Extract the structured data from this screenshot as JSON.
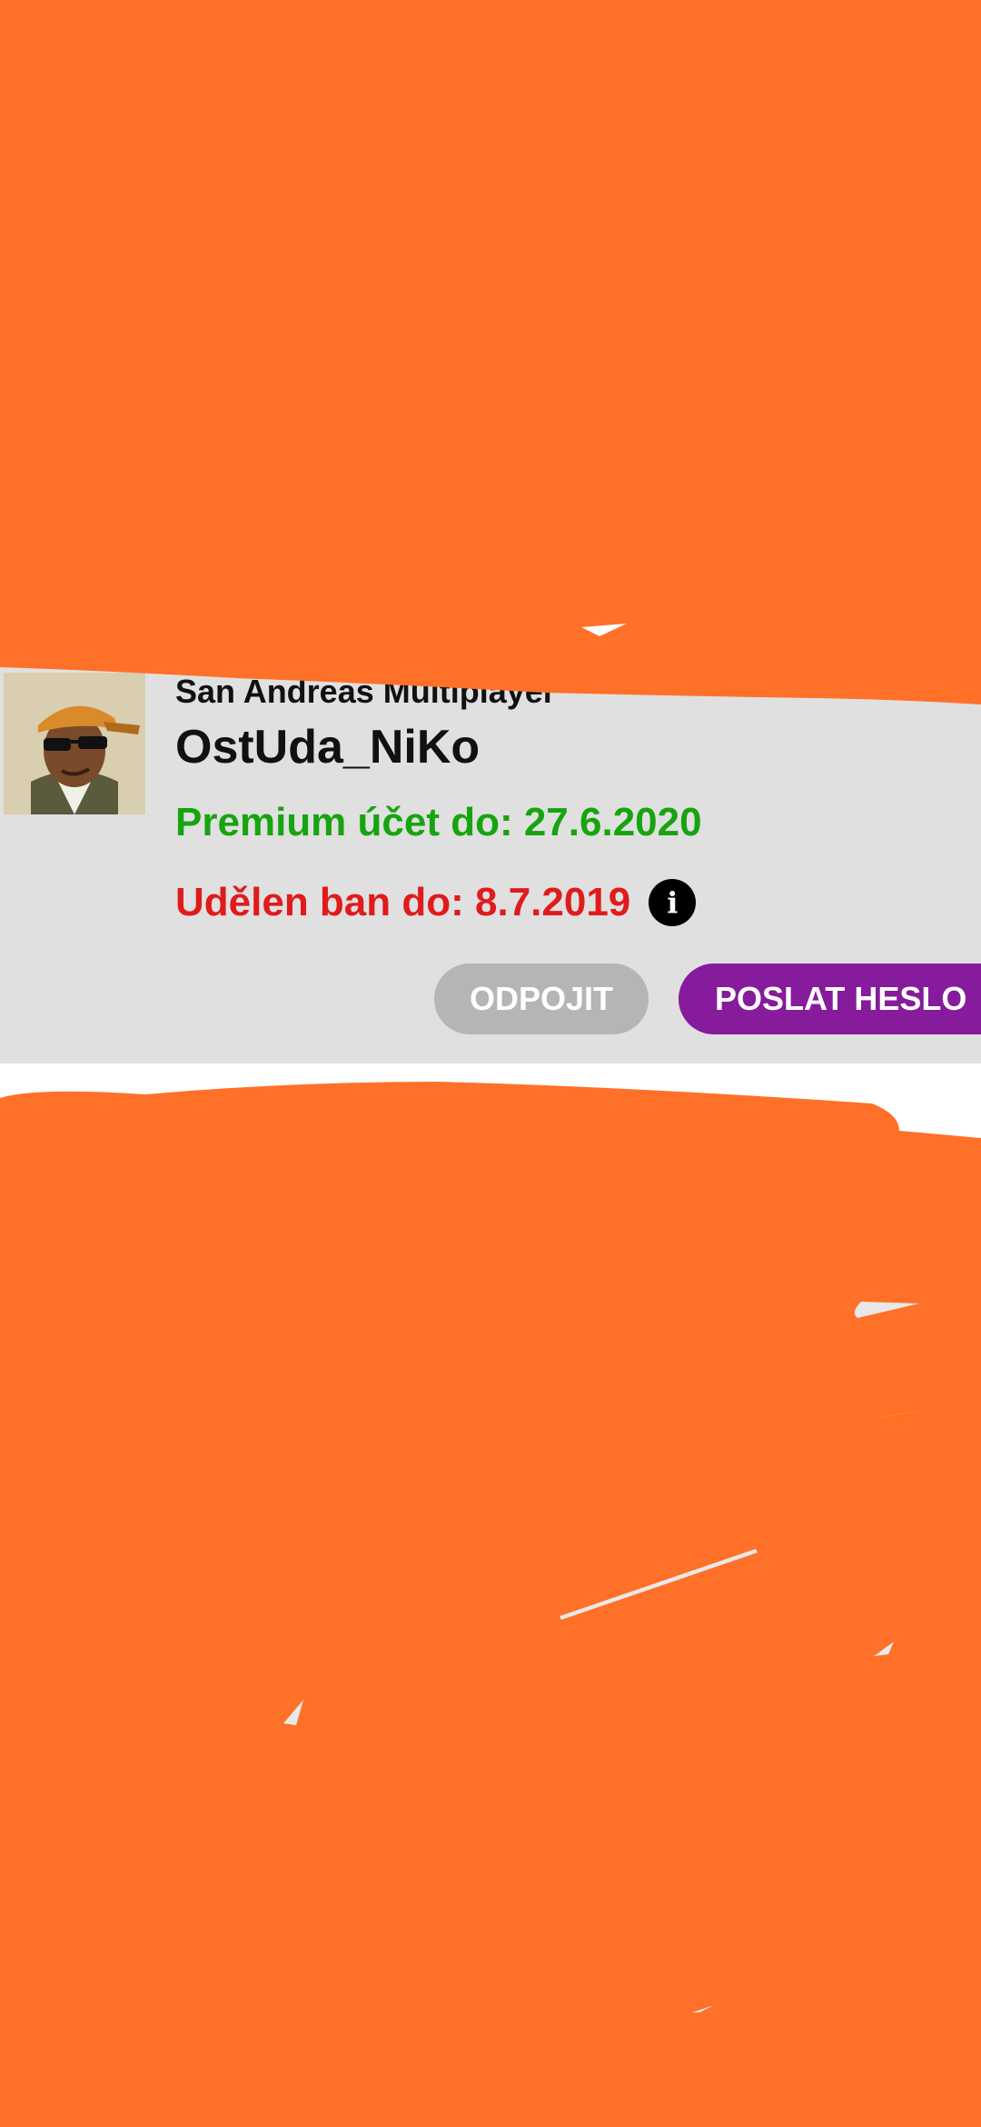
{
  "account": {
    "app_name": "San Andreas Multiplayer",
    "username": "OstUda_NiKo",
    "premium_text": "Premium účet do: 27.6.2020",
    "ban_text": "Udělen ban do: 8.7.2019",
    "info_icon": "info-icon",
    "avatar": "player-avatar"
  },
  "actions": {
    "disconnect_label": "ODPOJIT",
    "send_password_label": "POSLAT HESLO"
  },
  "colors": {
    "redaction": "#ff7028",
    "card_background": "#e0e0e0",
    "premium_green": "#17a40f",
    "ban_red": "#e01b1b",
    "disconnect_gray": "#b5b5b5",
    "send_purple": "#861b9c"
  }
}
